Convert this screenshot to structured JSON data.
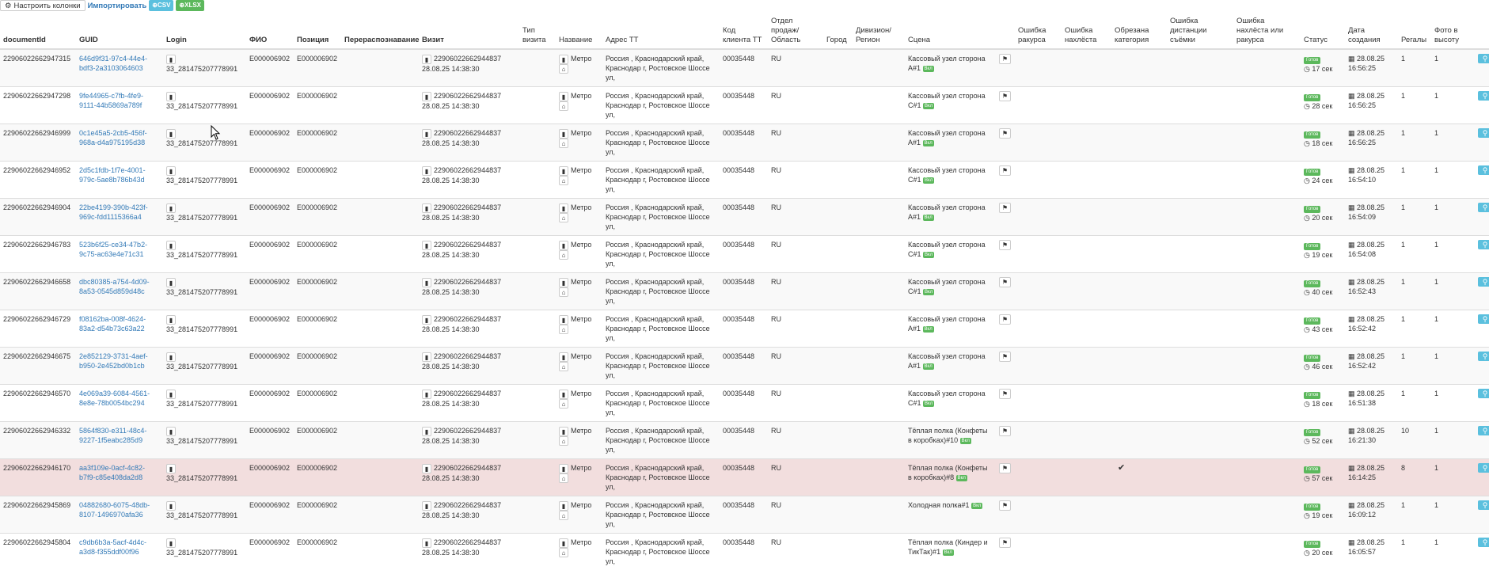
{
  "toolbar": {
    "configure_label": "Настроить колонки",
    "import_label": "Импортировать",
    "csv_label": "CSV",
    "xlsx_label": "XLSX"
  },
  "columns": [
    "documentId",
    "GUID",
    "Login",
    "ФИО",
    "Позиция",
    "Перераспознавание",
    "Визит",
    "Тип визита",
    "Название",
    "Адрес ТТ",
    "Код клиента ТТ",
    "Отдел продаж/ Область",
    "Город",
    "Дивизион/ Регион",
    "Сцена",
    "",
    "Ошибка ракурса",
    "Ошибка нахлёста",
    "Обрезана категория",
    "Ошибка дистанции съёмки",
    "Ошибка нахлёста или ракурса",
    "Статус",
    "Дата создания",
    "Регалы",
    "Фото в высоту",
    ""
  ],
  "common": {
    "login": "33_281475207778991",
    "fio": "E000006902",
    "position": "E000006902",
    "visit_id": "22906022662944837",
    "visit_date": "28.08.25 14:38:30",
    "name": "Метро",
    "address": "Россия , Краснодарский край, Краснодар г, Ростовское Шоссе ул,",
    "client_code": "00035448",
    "region": "RU",
    "status": "Готов",
    "date": "28.08.25",
    "scene_tag": "Вкл"
  },
  "rows": [
    {
      "doc_id": "22906022662947315",
      "guid": "646d9f31-97c4-44e4-bdf3-2a3103064603",
      "scene": "Кассовый узел сторона А#1",
      "elapsed": "17 сек",
      "time": "16:56:25",
      "regals": "1",
      "photo_height": "1",
      "crop": "",
      "highlight": false
    },
    {
      "doc_id": "22906022662947298",
      "guid": "9fe44965-c7fb-4fe9-9111-44b5869a789f",
      "scene": "Кассовый узел сторона С#1",
      "elapsed": "28 сек",
      "time": "16:56:25",
      "regals": "1",
      "photo_height": "1",
      "crop": "",
      "highlight": false
    },
    {
      "doc_id": "22906022662946999",
      "guid": "0c1e45a5-2cb5-456f-968a-d4a975195d38",
      "scene": "Кассовый узел сторона А#1",
      "elapsed": "18 сек",
      "time": "16:56:25",
      "regals": "1",
      "photo_height": "1",
      "crop": "",
      "highlight": false
    },
    {
      "doc_id": "22906022662946952",
      "guid": "2d5c1fdb-1f7e-4001-979c-5ae8b786b43d",
      "scene": "Кассовый узел сторона С#1",
      "elapsed": "24 сек",
      "time": "16:54:10",
      "regals": "1",
      "photo_height": "1",
      "crop": "",
      "highlight": false
    },
    {
      "doc_id": "22906022662946904",
      "guid": "22be4199-390b-423f-969c-fdd1115366a4",
      "scene": "Кассовый узел сторона А#1",
      "elapsed": "20 сек",
      "time": "16:54:09",
      "regals": "1",
      "photo_height": "1",
      "crop": "",
      "highlight": false
    },
    {
      "doc_id": "22906022662946783",
      "guid": "523b6f25-ce34-47b2-9c75-ac63e4e71c31",
      "scene": "Кассовый узел сторона С#1",
      "elapsed": "19 сек",
      "time": "16:54:08",
      "regals": "1",
      "photo_height": "1",
      "crop": "",
      "highlight": false
    },
    {
      "doc_id": "22906022662946658",
      "guid": "dbc80385-a754-4d09-8a53-0545d859d48c",
      "scene": "Кассовый узел сторона С#1",
      "elapsed": "40 сек",
      "time": "16:52:43",
      "regals": "1",
      "photo_height": "1",
      "crop": "",
      "highlight": false
    },
    {
      "doc_id": "22906022662946729",
      "guid": "f08162ba-008f-4624-83a2-d54b73c63a22",
      "scene": "Кассовый узел сторона А#1",
      "elapsed": "43 сек",
      "time": "16:52:42",
      "regals": "1",
      "photo_height": "1",
      "crop": "",
      "highlight": false
    },
    {
      "doc_id": "22906022662946675",
      "guid": "2e852129-3731-4aef-b950-2e452bd0b1cb",
      "scene": "Кассовый узел сторона А#1",
      "elapsed": "46 сек",
      "time": "16:52:42",
      "regals": "1",
      "photo_height": "1",
      "crop": "",
      "highlight": false
    },
    {
      "doc_id": "22906022662946570",
      "guid": "4e069a39-6084-4561-8e8e-78b0054bc294",
      "scene": "Кассовый узел сторона С#1",
      "elapsed": "18 сек",
      "time": "16:51:38",
      "regals": "1",
      "photo_height": "1",
      "crop": "",
      "highlight": false
    },
    {
      "doc_id": "22906022662946332",
      "guid": "5864f830-e311-48c4-9227-1f5eabc285d9",
      "scene": "Тёплая полка (Конфеты в коробках)#10",
      "elapsed": "52 сек",
      "time": "16:21:30",
      "regals": "10",
      "photo_height": "1",
      "crop": "",
      "highlight": false
    },
    {
      "doc_id": "22906022662946170",
      "guid": "aa3f109e-0acf-4c82-b7f9-c85e408da2d8",
      "scene": "Тёплая полка (Конфеты в коробках)#8",
      "elapsed": "57 сек",
      "time": "16:14:25",
      "regals": "8",
      "photo_height": "1",
      "crop": "✔",
      "highlight": true
    },
    {
      "doc_id": "22906022662945869",
      "guid": "04882680-6075-48db-8107-1496970afa36",
      "scene": "Холодная полка#1",
      "elapsed": "19 сек",
      "time": "16:09:12",
      "regals": "1",
      "photo_height": "1",
      "crop": "",
      "highlight": false
    },
    {
      "doc_id": "22906022662945804",
      "guid": "c9db6b3a-5acf-4d4c-a3d8-f355ddf00f96",
      "scene": "Тёплая полка (Киндер и ТикТак)#1",
      "elapsed": "20 сек",
      "time": "16:05:57",
      "regals": "1",
      "photo_height": "1",
      "crop": "",
      "highlight": false
    }
  ]
}
